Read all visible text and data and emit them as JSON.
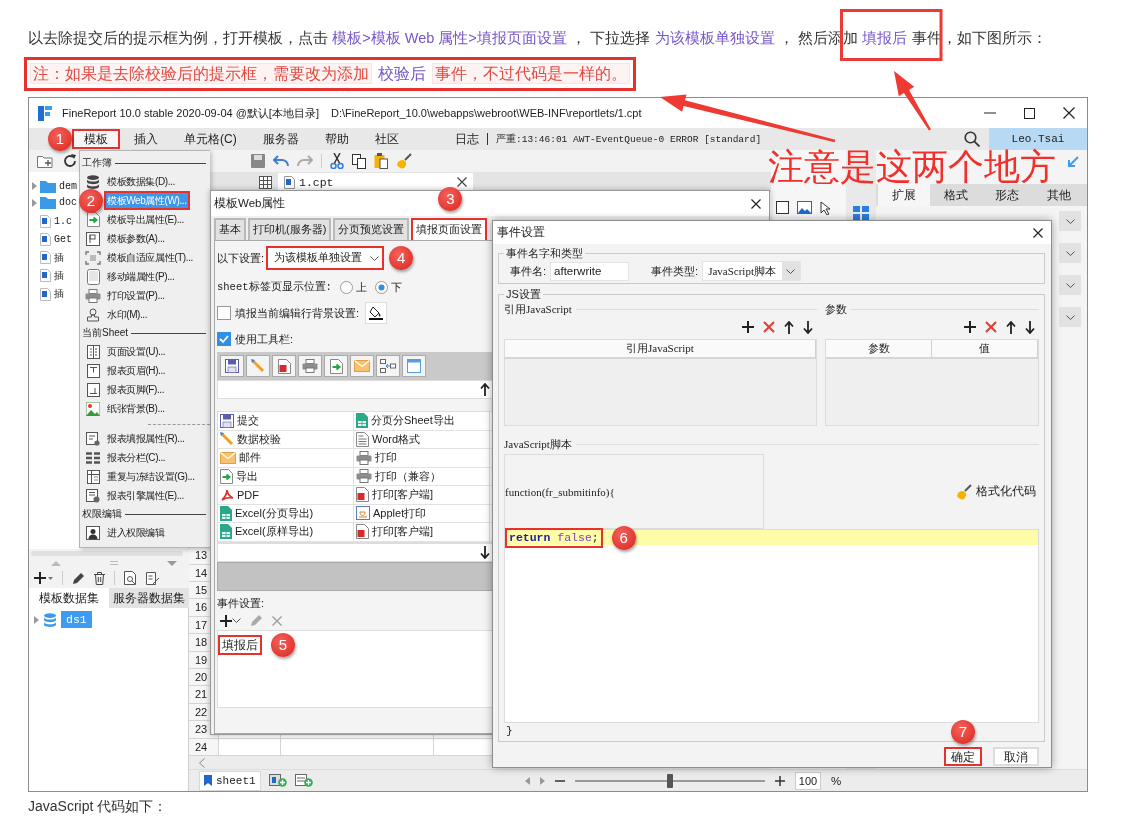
{
  "article": {
    "intro": [
      {
        "kind": "plain",
        "text": "以去除提交后的提示框为例，打开模板，点击 "
      },
      {
        "kind": "link",
        "text": "模板>模板 Web 属性>填报页面设置"
      },
      {
        "kind": "plain",
        "text": " ， 下拉选择 "
      },
      {
        "kind": "link",
        "text": "为该模板单独设置"
      },
      {
        "kind": "plain",
        "text": " ， 然后添加 "
      },
      {
        "kind": "link",
        "text": "填报后"
      },
      {
        "kind": "plain",
        "text": " 事件，如下图所示："
      }
    ],
    "note": {
      "annotated": true,
      "segments": [
        {
          "kind": "warning",
          "text": "注：如果是去除校验后的提示框，需要改为添加"
        },
        {
          "kind": "link",
          "text": "校验后"
        },
        {
          "kind": "warning",
          "text": "事件，不过代码是一样的。"
        }
      ]
    },
    "footer": "JavaScript 代码如下："
  },
  "app": {
    "title": "FineReport 10.0 stable 2020-09-04 @默认[本地目录]",
    "path": "D:\\FineReport_10.0\\webapps\\webroot\\WEB-INF\\reportlets/1.cpt",
    "menus": [
      {
        "label": "模板",
        "selected": true,
        "annotated": true,
        "badge": "1"
      },
      {
        "label": "插入",
        "selected": false,
        "annotated": false
      },
      {
        "label": "单元格(C)",
        "selected": false,
        "annotated": false
      },
      {
        "label": "服务器",
        "selected": false,
        "annotated": false
      },
      {
        "label": "帮助",
        "selected": false,
        "annotated": false
      },
      {
        "label": "社区",
        "selected": false,
        "annotated": false
      }
    ],
    "log_label": "日志",
    "log_message": "严重:13:46:01 AWT-EventQueue-0 ERROR [standard]",
    "user": "Leo.Tsai",
    "file_tree": [
      {
        "kind": "folder",
        "label": "dem"
      },
      {
        "kind": "folder",
        "label": "doc"
      },
      {
        "kind": "file",
        "label": "1.c"
      },
      {
        "kind": "file",
        "label": "Get"
      },
      {
        "kind": "file",
        "label": "插"
      },
      {
        "kind": "file",
        "label": "插"
      },
      {
        "kind": "file",
        "label": "插"
      }
    ],
    "dataset_tabs": [
      {
        "label": "模板数据集",
        "selected": true
      },
      {
        "label": "服务器数据集",
        "selected": false
      }
    ],
    "datasets": [
      {
        "label": "ds1",
        "selected": true
      }
    ],
    "editor_tab": "1.cpt",
    "row_numbers": [
      "13",
      "14",
      "15",
      "16",
      "17",
      "18",
      "19",
      "20",
      "21",
      "22",
      "23",
      "24"
    ],
    "sheet_tabs": [
      {
        "label": "sheet1",
        "selected": true
      }
    ],
    "zoom": {
      "level": 0.5,
      "value": "100",
      "unit": "%"
    },
    "property_panel": {
      "tabs": [
        {
          "label": "扩展",
          "selected": true
        },
        {
          "label": "格式",
          "selected": false
        },
        {
          "label": "形态",
          "selected": false
        },
        {
          "label": "其他",
          "selected": false
        }
      ]
    }
  },
  "template_menu": {
    "sections": [
      {
        "title": "工作簿",
        "items": [
          {
            "label": "模板数据集(D)...",
            "selected": false,
            "annotated": false
          },
          {
            "label": "模板Web属性(W)...",
            "selected": true,
            "annotated": true,
            "badge": "2"
          },
          {
            "label": "模板导出属性(E)...",
            "selected": false,
            "annotated": false
          },
          {
            "label": "模板参数(A)...",
            "selected": false,
            "annotated": false
          },
          {
            "label": "模板自适应属性(T)...",
            "selected": false,
            "annotated": false
          },
          {
            "label": "移动端属性(P)...",
            "selected": false,
            "annotated": false
          },
          {
            "label": "打印设置(P)...",
            "selected": false,
            "annotated": false
          },
          {
            "label": "水印(M)...",
            "selected": false,
            "annotated": false
          }
        ]
      },
      {
        "title": "当前Sheet",
        "items": [
          {
            "label": "页面设置(U)...",
            "selected": false,
            "annotated": false
          },
          {
            "label": "报表页眉(H)...",
            "selected": false,
            "annotated": false
          },
          {
            "label": "报表页脚(F)...",
            "selected": false,
            "annotated": false
          },
          {
            "label": "纸张背景(B)...",
            "selected": false,
            "annotated": false
          }
        ]
      },
      {
        "items": [
          {
            "label": "报表填报属性(R)...",
            "selected": false,
            "annotated": false
          },
          {
            "label": "报表分栏(C)...",
            "selected": false,
            "annotated": false
          },
          {
            "label": "重复与冻结设置(G)...",
            "selected": false,
            "annotated": false
          },
          {
            "label": "报表引擎属性(E)...",
            "selected": false,
            "annotated": false
          }
        ]
      },
      {
        "title": "权限编辑",
        "items": [
          {
            "label": "进入权限编辑",
            "selected": false,
            "annotated": false
          }
        ]
      }
    ]
  },
  "web_dialog": {
    "title": "模板Web属性",
    "tabs": [
      {
        "label": "基本",
        "selected": false,
        "annotated": false
      },
      {
        "label": "打印机(服务器)",
        "selected": false,
        "annotated": false
      },
      {
        "label": "分页预览设置",
        "selected": false,
        "annotated": false
      },
      {
        "label": "填报页面设置",
        "selected": true,
        "annotated": true,
        "badge": "3"
      }
    ],
    "scope": {
      "label": "以下设置:",
      "value": "为该模板单独设置",
      "annotated": true,
      "badge": "4"
    },
    "sheet_position": {
      "label": "sheet标签页显示位置:",
      "options": [
        {
          "label": "上",
          "selected": false
        },
        {
          "label": "下",
          "selected": true
        }
      ]
    },
    "row_background": {
      "label": "填报当前编辑行背景设置:",
      "checked": false
    },
    "use_toolbar": {
      "label": "使用工具栏:",
      "checked": true
    },
    "toolbar_buttons": [
      {
        "label": "提交"
      },
      {
        "label": "分页分Sheet导出"
      },
      {
        "label": "数据校验"
      },
      {
        "label": "Word格式"
      },
      {
        "label": "邮件"
      },
      {
        "label": "打印"
      },
      {
        "label": "导出"
      },
      {
        "label": "打印（兼容）"
      },
      {
        "label": "PDF"
      },
      {
        "label": "打印[客户端]"
      },
      {
        "label": "Excel(分页导出)"
      },
      {
        "label": "Applet打印"
      },
      {
        "label": "Excel(原样导出)"
      },
      {
        "label": "打印[客户端]"
      }
    ],
    "event_label": "事件设置:",
    "events": [
      {
        "label": "填报后",
        "annotated": true,
        "badge": "5"
      }
    ]
  },
  "event_dialog": {
    "title": "事件设置",
    "name_group": "事件名字和类型",
    "name_label": "事件名:",
    "name_value": "afterwrite",
    "type_label": "事件类型:",
    "type_value": "JavaScript脚本",
    "js_group": "JS设置",
    "ref_title": "引用JavaScript",
    "ref_columns": [
      "引用JavaScript"
    ],
    "param_title": "参数",
    "param_columns": [
      "参数",
      "值"
    ],
    "script_title": "JavaScript脚本",
    "signature": "function(fr_submitinfo){",
    "format_label": "格式化代码",
    "code_lines": [
      {
        "highlighted": true,
        "annotated": true,
        "badge": "6",
        "tokens": [
          {
            "kind": "keyword",
            "text": "return "
          },
          {
            "kind": "literal",
            "text": "false"
          },
          {
            "kind": "plain",
            "text": ";"
          }
        ]
      }
    ],
    "closing": "}",
    "buttons": [
      {
        "label": "确定",
        "annotated": true,
        "badge": "7"
      },
      {
        "label": "取消",
        "annotated": false
      }
    ]
  },
  "callout": "注意是这两个地方"
}
